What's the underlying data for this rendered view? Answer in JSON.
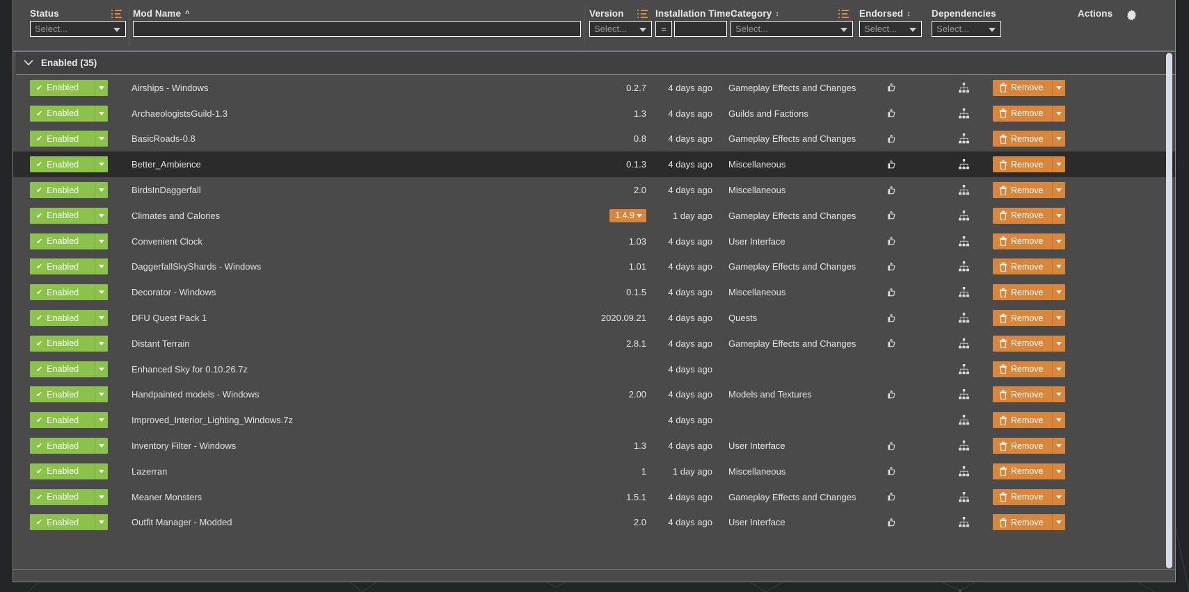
{
  "header": {
    "columns": [
      {
        "label": "Status",
        "sort": "",
        "filter_icon": "filter-list-icon",
        "control": "select",
        "placeholder": "Select..."
      },
      {
        "label": "Mod Name",
        "sort": "^",
        "filter_icon": "",
        "control": "text",
        "placeholder": ""
      },
      {
        "label": "Version",
        "sort": "",
        "filter_icon": "filter-list-icon",
        "control": "select",
        "placeholder": "Select..."
      },
      {
        "label": "Installation Time",
        "sort": "↕",
        "filter_icon": "",
        "control": "equals",
        "equals_label": "=",
        "placeholder": ""
      },
      {
        "label": "Category",
        "sort": "↕",
        "filter_icon": "filter-list-icon",
        "control": "select",
        "placeholder": "Select..."
      },
      {
        "label": "Endorsed",
        "sort": "↕",
        "filter_icon": "",
        "control": "select",
        "placeholder": "Select..."
      },
      {
        "label": "Dependencies",
        "sort": "",
        "filter_icon": "",
        "control": "select",
        "placeholder": "Select..."
      },
      {
        "label": "Actions",
        "sort": "",
        "filter_icon": "",
        "control": "none",
        "placeholder": ""
      }
    ],
    "settings_icon": "gear-icon"
  },
  "group": {
    "chevron": "chevron-down-icon",
    "title": "Enabled (35)"
  },
  "labels": {
    "status_enabled": "Enabled",
    "status_check": "✔",
    "remove": "Remove",
    "endorse_icon": "thumbs-up-icon",
    "dependency_icon": "sitemap-icon",
    "trash_icon": "trash-icon"
  },
  "colors": {
    "enabled_green": "#8bc34a",
    "action_orange": "#d9863b",
    "panel_bg": "#4a4a4a",
    "row_selected": "#2b2b2b",
    "accent_filter": "#d98c3f",
    "scrollbar": "#d5dde6"
  },
  "rows": [
    {
      "status": "Enabled",
      "name": "Airships - Windows",
      "version": "0.2.7",
      "version_highlight": false,
      "time": "4 days ago",
      "category": "Gameplay Effects and Changes",
      "endorsed": true,
      "dependency": true,
      "action": "Remove",
      "selected": false
    },
    {
      "status": "Enabled",
      "name": "ArchaeologistsGuild-1.3",
      "version": "1.3",
      "version_highlight": false,
      "time": "4 days ago",
      "category": "Guilds and Factions",
      "endorsed": true,
      "dependency": true,
      "action": "Remove",
      "selected": false
    },
    {
      "status": "Enabled",
      "name": "BasicRoads-0.8",
      "version": "0.8",
      "version_highlight": false,
      "time": "4 days ago",
      "category": "Gameplay Effects and Changes",
      "endorsed": true,
      "dependency": true,
      "action": "Remove",
      "selected": false
    },
    {
      "status": "Enabled",
      "name": "Better_Ambience",
      "version": "0.1.3",
      "version_highlight": false,
      "time": "4 days ago",
      "category": "Miscellaneous",
      "endorsed": true,
      "dependency": true,
      "action": "Remove",
      "selected": true
    },
    {
      "status": "Enabled",
      "name": "BirdsInDaggerfall",
      "version": "2.0",
      "version_highlight": false,
      "time": "4 days ago",
      "category": "Miscellaneous",
      "endorsed": true,
      "dependency": true,
      "action": "Remove",
      "selected": false
    },
    {
      "status": "Enabled",
      "name": "Climates and Calories",
      "version": "1.4.9",
      "version_highlight": true,
      "time": "1 day ago",
      "category": "Gameplay Effects and Changes",
      "endorsed": true,
      "dependency": true,
      "action": "Remove",
      "selected": false
    },
    {
      "status": "Enabled",
      "name": "Convenient Clock",
      "version": "1.03",
      "version_highlight": false,
      "time": "4 days ago",
      "category": "User Interface",
      "endorsed": true,
      "dependency": true,
      "action": "Remove",
      "selected": false
    },
    {
      "status": "Enabled",
      "name": "DaggerfallSkyShards - Windows",
      "version": "1.01",
      "version_highlight": false,
      "time": "4 days ago",
      "category": "Gameplay Effects and Changes",
      "endorsed": true,
      "dependency": true,
      "action": "Remove",
      "selected": false
    },
    {
      "status": "Enabled",
      "name": "Decorator - Windows",
      "version": "0.1.5",
      "version_highlight": false,
      "time": "4 days ago",
      "category": "Miscellaneous",
      "endorsed": true,
      "dependency": true,
      "action": "Remove",
      "selected": false
    },
    {
      "status": "Enabled",
      "name": "DFU Quest Pack 1",
      "version": "2020.09.21",
      "version_highlight": false,
      "time": "4 days ago",
      "category": "Quests",
      "endorsed": true,
      "dependency": true,
      "action": "Remove",
      "selected": false
    },
    {
      "status": "Enabled",
      "name": "Distant Terrain",
      "version": "2.8.1",
      "version_highlight": false,
      "time": "4 days ago",
      "category": "Gameplay Effects and Changes",
      "endorsed": true,
      "dependency": true,
      "action": "Remove",
      "selected": false
    },
    {
      "status": "Enabled",
      "name": "Enhanced Sky for 0.10.26.7z",
      "version": "",
      "version_highlight": false,
      "time": "4 days ago",
      "category": "",
      "endorsed": false,
      "dependency": true,
      "action": "Remove",
      "selected": false
    },
    {
      "status": "Enabled",
      "name": "Handpainted models - Windows",
      "version": "2.00",
      "version_highlight": false,
      "time": "4 days ago",
      "category": "Models and Textures",
      "endorsed": true,
      "dependency": true,
      "action": "Remove",
      "selected": false
    },
    {
      "status": "Enabled",
      "name": "Improved_Interior_Lighting_Windows.7z",
      "version": "",
      "version_highlight": false,
      "time": "4 days ago",
      "category": "",
      "endorsed": false,
      "dependency": true,
      "action": "Remove",
      "selected": false
    },
    {
      "status": "Enabled",
      "name": "Inventory Filter - Windows",
      "version": "1.3",
      "version_highlight": false,
      "time": "4 days ago",
      "category": "User Interface",
      "endorsed": true,
      "dependency": true,
      "action": "Remove",
      "selected": false
    },
    {
      "status": "Enabled",
      "name": "Lazerran",
      "version": "1",
      "version_highlight": false,
      "time": "1 day ago",
      "category": "Miscellaneous",
      "endorsed": true,
      "dependency": true,
      "action": "Remove",
      "selected": false
    },
    {
      "status": "Enabled",
      "name": "Meaner Monsters",
      "version": "1.5.1",
      "version_highlight": false,
      "time": "4 days ago",
      "category": "Gameplay Effects and Changes",
      "endorsed": true,
      "dependency": true,
      "action": "Remove",
      "selected": false
    },
    {
      "status": "Enabled",
      "name": "Outfit Manager - Modded",
      "version": "2.0",
      "version_highlight": false,
      "time": "4 days ago",
      "category": "User Interface",
      "endorsed": true,
      "dependency": true,
      "action": "Remove",
      "selected": false
    }
  ]
}
